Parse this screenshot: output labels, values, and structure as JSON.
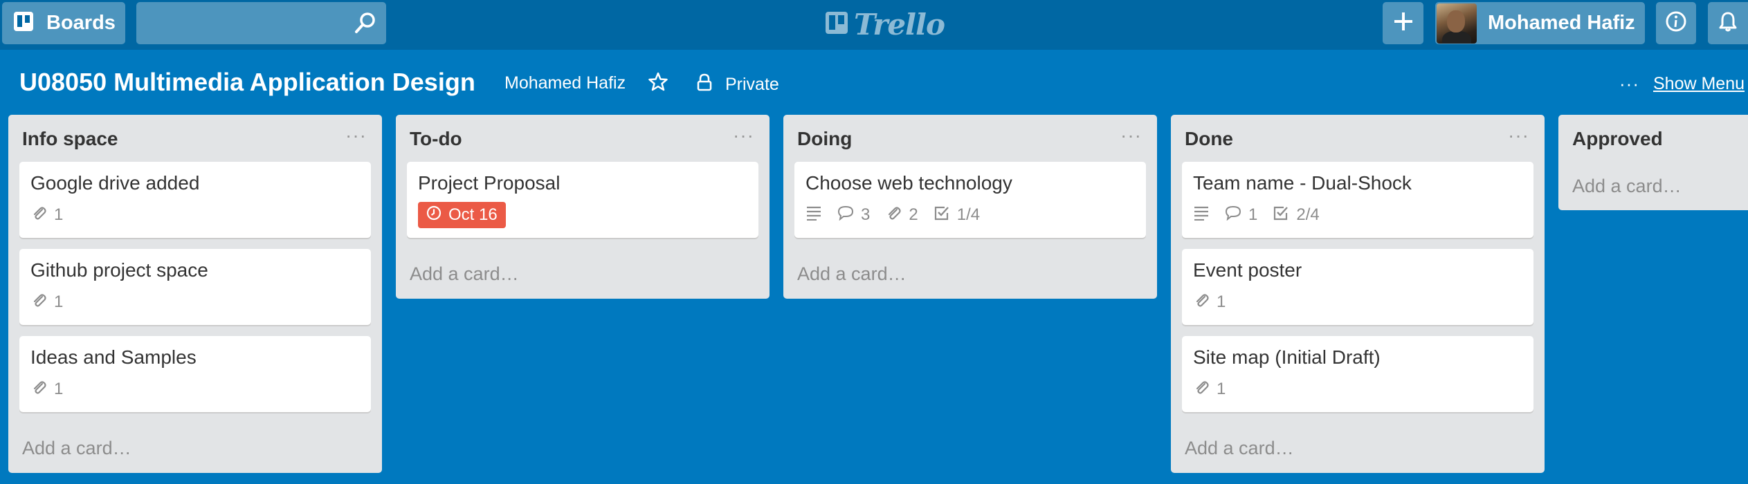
{
  "header": {
    "boards_label": "Boards",
    "search_placeholder": "",
    "logo_text": "Trello",
    "member_name": "Mohamed Hafiz"
  },
  "board": {
    "title": "U08050 Multimedia Application Design",
    "owner": "Mohamed Hafiz",
    "visibility": "Private",
    "show_menu": "Show Menu",
    "menu_dots": "···"
  },
  "lists": [
    {
      "title": "Info space",
      "menu": "···",
      "cards": [
        {
          "title": "Google drive added",
          "attachments": "1"
        },
        {
          "title": "Github project space",
          "attachments": "1"
        },
        {
          "title": "Ideas and Samples",
          "attachments": "1"
        }
      ],
      "add_card": "Add a card…"
    },
    {
      "title": "To-do",
      "menu": "···",
      "cards": [
        {
          "title": "Project Proposal",
          "due": "Oct 16"
        }
      ],
      "add_card": "Add a card…"
    },
    {
      "title": "Doing",
      "menu": "···",
      "cards": [
        {
          "title": "Choose web technology",
          "comments": "3",
          "attachments": "2",
          "checklist": "1/4"
        }
      ],
      "add_card": "Add a card…"
    },
    {
      "title": "Done",
      "menu": "···",
      "cards": [
        {
          "title": "Team name - Dual-Shock",
          "comments": "1",
          "checklist": "2/4"
        },
        {
          "title": "Event poster",
          "attachments": "1"
        },
        {
          "title": "Site map (Initial Draft)",
          "attachments": "1"
        }
      ],
      "add_card": "Add a card…"
    },
    {
      "title": "Approved",
      "add_card": "Add a card…"
    }
  ],
  "colors": {
    "board_bg": "#0079bf",
    "header_bg": "#0067a3",
    "due_badge": "#eb5a46",
    "list_bg": "#e2e4e6"
  }
}
